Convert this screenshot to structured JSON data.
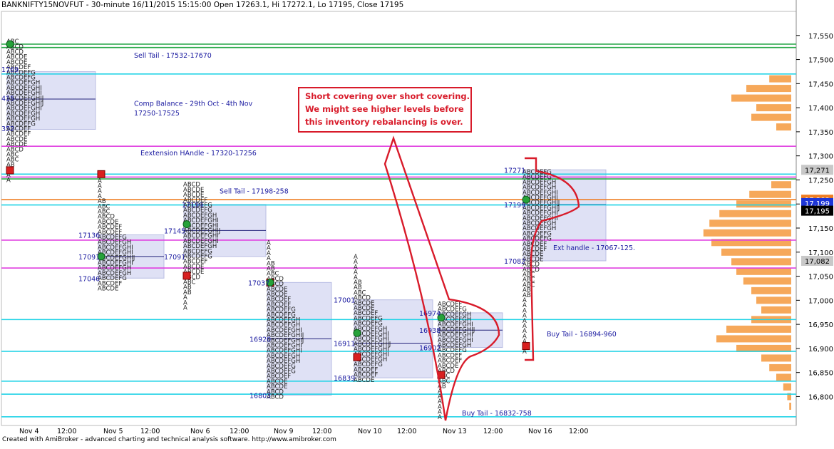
{
  "header": {
    "title": "BANKNIFTY15NOVFUT - 30-minute 16/11/2015 15:15:00 Open 17263.1, Hi 17272.1, Lo 17195, Close 17195"
  },
  "footer": "Created with AmiBroker - advanced charting and technical analysis software. http://www.amibroker.com",
  "annotation": {
    "lines": [
      "Short covering over short covering.",
      "We might see higher levels before",
      "this inventory rebalancing is over."
    ]
  },
  "chart_data": {
    "type": "market-profile",
    "ylim": [
      16740,
      17600
    ],
    "y_ticks": [
      16800,
      16850,
      16900,
      16950,
      17000,
      17050,
      17100,
      17150,
      17200,
      17250,
      17300,
      17350,
      17400,
      17450,
      17500,
      17550
    ],
    "y_tick_labels": [
      "16,800",
      "16,850",
      "16,900",
      "16,950",
      "17,000",
      "17,050",
      "17,100",
      "17,150",
      "17,200",
      "17,250",
      "17,300",
      "17,350",
      "17,400",
      "17,450",
      "17,500",
      "17,550"
    ],
    "x_labels": [
      "Nov 4",
      "12:00",
      "Nov 5",
      "12:00",
      "Nov 6",
      "12:00",
      "Nov 9",
      "12:00",
      "Nov 10",
      "12:00",
      "Nov 13",
      "12:00",
      "Nov 16",
      "12:00"
    ],
    "price_badges": [
      {
        "label": "17,271",
        "value": 17271,
        "color": "#c8c8c8",
        "text_color": "#000000"
      },
      {
        "label": "17,209",
        "value": 17209,
        "color": "#ef7d22",
        "text_color": "#ffffff"
      },
      {
        "label": "17,199",
        "value": 17199,
        "color": "#1e36d8",
        "text_color": "#ffffff"
      },
      {
        "label": "17,195",
        "value": 17195,
        "color": "#000000",
        "text_color": "#ffffff"
      },
      {
        "label": "17,082",
        "value": 17082,
        "color": "#c8c8c8",
        "text_color": "#000000"
      }
    ],
    "zone_labels": [
      {
        "text": "Sell Tail - 17532-17670",
        "value": 17510
      },
      {
        "text": "Comp Balance - 29th Oct - 4th Nov",
        "value": 17410
      },
      {
        "text": "17250-17525",
        "value": 17390
      },
      {
        "text": "Eextension HAndle - 17320-17256",
        "value": 17307
      },
      {
        "text": "Sell Tail - 17198-258",
        "value": 17228
      },
      {
        "text": "Ext handle - 17067-125.",
        "value": 17110
      },
      {
        "text": "Buy Tail - 16894-960",
        "value": 16931
      },
      {
        "text": "Buy Tail - 16832-758",
        "value": 16767
      }
    ],
    "value_labels": [
      {
        "text": "1769",
        "value": 17480
      },
      {
        "text": "415",
        "value": 17420
      },
      {
        "text": "352",
        "value": 17357
      },
      {
        "text": "17136",
        "value": 17136
      },
      {
        "text": "17091",
        "value": 17091
      },
      {
        "text": "17046",
        "value": 17046
      },
      {
        "text": "17199",
        "value": 17199
      },
      {
        "text": "17145",
        "value": 17145
      },
      {
        "text": "17091",
        "value": 17091
      },
      {
        "text": "17037",
        "value": 17037
      },
      {
        "text": "16920",
        "value": 16920
      },
      {
        "text": "16803",
        "value": 16803
      },
      {
        "text": "17001",
        "value": 17001
      },
      {
        "text": "16911",
        "value": 16911
      },
      {
        "text": "16839",
        "value": 16839
      },
      {
        "text": "16974",
        "value": 16974
      },
      {
        "text": "16938",
        "value": 16938
      },
      {
        "text": "16902",
        "value": 16902
      },
      {
        "text": "17271",
        "value": 17271
      },
      {
        "text": "17199",
        "value": 17199
      },
      {
        "text": "17082",
        "value": 17082
      }
    ],
    "horizontal_levels": [
      {
        "value": 17532,
        "color": "#2aa84a"
      },
      {
        "value": 17525,
        "color": "#2aa84a"
      },
      {
        "value": 17470,
        "color": "#22d3e6"
      },
      {
        "value": 17320,
        "color": "#e040e0"
      },
      {
        "value": 17256,
        "color": "#e040e0"
      },
      {
        "value": 17262,
        "color": "#22d3e6"
      },
      {
        "value": 17252,
        "color": "#2aa84a"
      },
      {
        "value": 17209,
        "color": "#ef7d22"
      },
      {
        "value": 17198,
        "color": "#22d3e6"
      },
      {
        "value": 17125,
        "color": "#e040e0"
      },
      {
        "value": 17067,
        "color": "#e040e0"
      },
      {
        "value": 16960,
        "color": "#22d3e6"
      },
      {
        "value": 16894,
        "color": "#22d3e6"
      },
      {
        "value": 16832,
        "color": "#22d3e6"
      },
      {
        "value": 16805,
        "color": "#22d3e6"
      },
      {
        "value": 16758,
        "color": "#22d3e6"
      }
    ],
    "sessions": [
      {
        "day": "Nov 4",
        "high": 17540,
        "low": 17250,
        "val": 17355,
        "vah": 17475,
        "poc": 17418,
        "open": 17270,
        "close": 17532
      },
      {
        "day": "Nov 5",
        "high": 17262,
        "low": 17025,
        "val": 17046,
        "vah": 17136,
        "poc": 17091,
        "open": 17262,
        "close": 17091
      },
      {
        "day": "Nov 6",
        "high": 17250,
        "low": 16985,
        "val": 17091,
        "vah": 17199,
        "poc": 17145,
        "open": 17051,
        "close": 17158
      },
      {
        "day": "Nov 9",
        "high": 17130,
        "low": 16800,
        "val": 16803,
        "vah": 17037,
        "poc": 16920,
        "open": 17037,
        "close": 17037
      },
      {
        "day": "Nov 10",
        "high": 17095,
        "low": 16835,
        "val": 16839,
        "vah": 17001,
        "poc": 16911,
        "open": 16882,
        "close": 16932
      },
      {
        "day": "Nov 13",
        "high": 17000,
        "low": 16758,
        "val": 16902,
        "vah": 16974,
        "poc": 16938,
        "open": 16845,
        "close": 16964
      },
      {
        "day": "Nov 16",
        "high": 17272,
        "low": 16894,
        "val": 17082,
        "vah": 17271,
        "poc": 17199,
        "open": 16905,
        "close": 17209
      }
    ],
    "volume_profile": [
      {
        "price": 17460,
        "size": 0.22
      },
      {
        "price": 17440,
        "size": 0.45
      },
      {
        "price": 17420,
        "size": 0.6
      },
      {
        "price": 17400,
        "size": 0.35
      },
      {
        "price": 17380,
        "size": 0.4
      },
      {
        "price": 17360,
        "size": 0.15
      },
      {
        "price": 17240,
        "size": 0.2
      },
      {
        "price": 17220,
        "size": 0.42
      },
      {
        "price": 17200,
        "size": 0.55
      },
      {
        "price": 17180,
        "size": 0.72
      },
      {
        "price": 17160,
        "size": 0.82
      },
      {
        "price": 17140,
        "size": 0.88
      },
      {
        "price": 17120,
        "size": 0.8
      },
      {
        "price": 17100,
        "size": 0.7
      },
      {
        "price": 17080,
        "size": 0.6
      },
      {
        "price": 17060,
        "size": 0.55
      },
      {
        "price": 17040,
        "size": 0.48
      },
      {
        "price": 17020,
        "size": 0.4
      },
      {
        "price": 17000,
        "size": 0.35
      },
      {
        "price": 16980,
        "size": 0.3
      },
      {
        "price": 16960,
        "size": 0.4
      },
      {
        "price": 16940,
        "size": 0.65
      },
      {
        "price": 16920,
        "size": 0.75
      },
      {
        "price": 16900,
        "size": 0.55
      },
      {
        "price": 16880,
        "size": 0.3
      },
      {
        "price": 16860,
        "size": 0.22
      },
      {
        "price": 16840,
        "size": 0.15
      },
      {
        "price": 16820,
        "size": 0.08
      },
      {
        "price": 16800,
        "size": 0.04
      },
      {
        "price": 16780,
        "size": 0.02
      }
    ]
  }
}
